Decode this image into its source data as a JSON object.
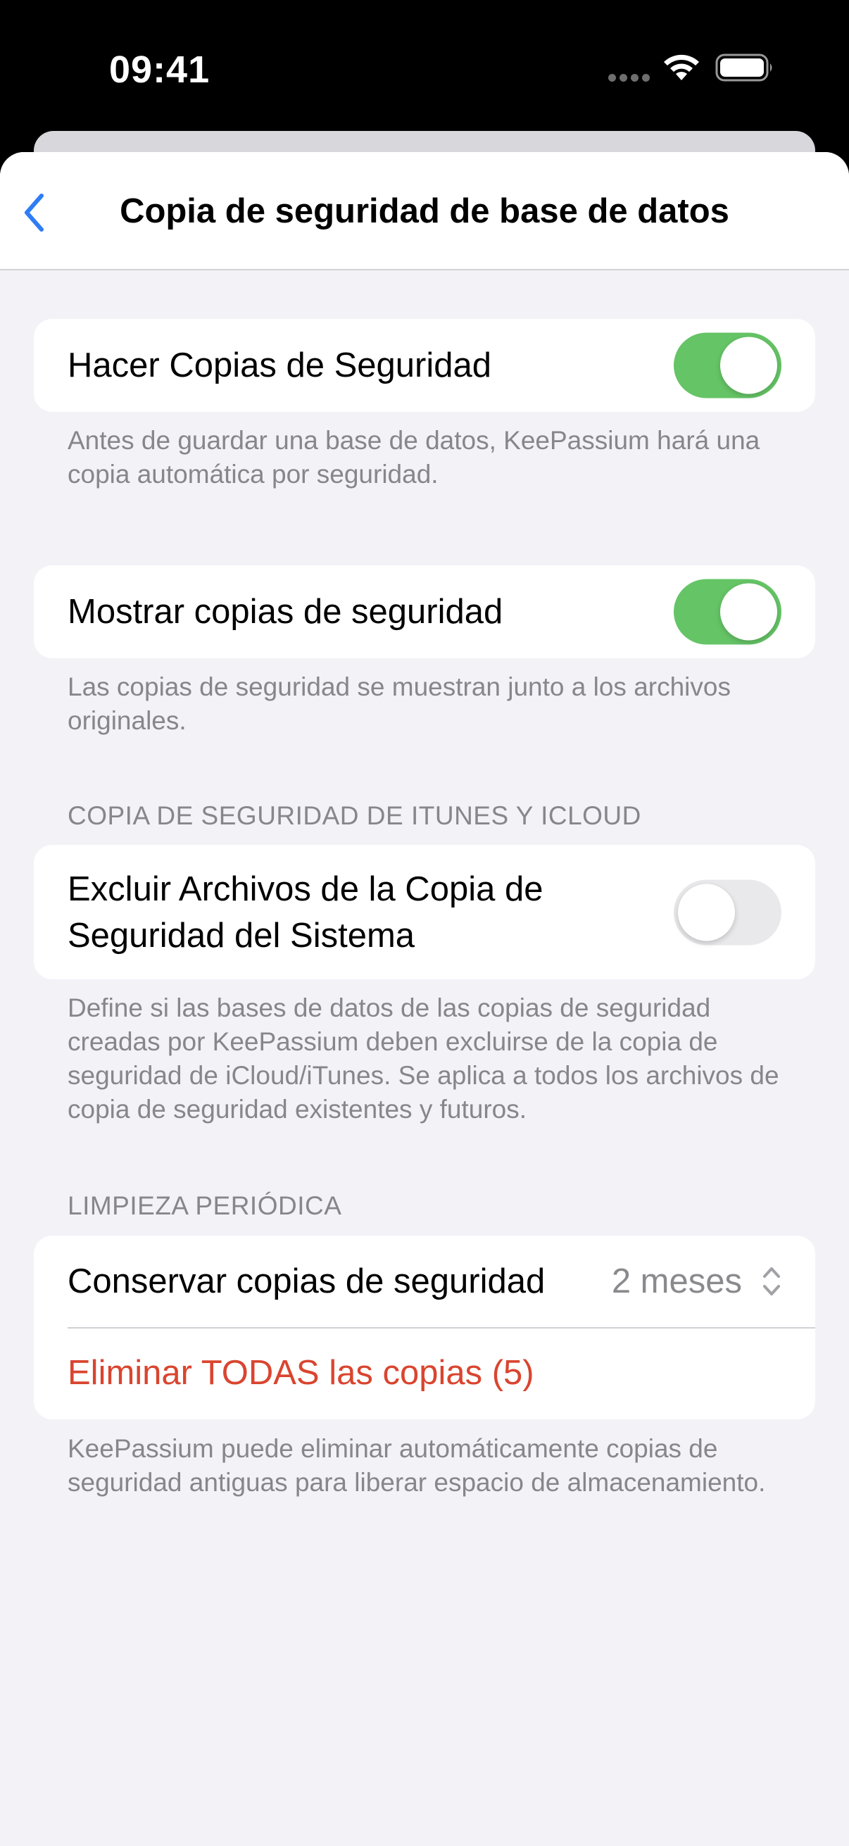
{
  "status_bar": {
    "time": "09:41",
    "icons": [
      "cellular-dots-icon",
      "wifi-icon",
      "battery-icon"
    ]
  },
  "nav": {
    "back_icon": "chevron-left-icon",
    "title": "Copia de seguridad de base de datos"
  },
  "sections": {
    "backup": {
      "label": "Hacer Copias de Seguridad",
      "enabled": true,
      "footer": "Antes de guardar una base de datos, KeePassium hará una copia automática por seguridad."
    },
    "show_backups": {
      "label": "Mostrar copias de seguridad",
      "enabled": true,
      "footer": "Las copias de seguridad se muestran junto a los archivos originales."
    },
    "itunes_icloud": {
      "header": "COPIA DE SEGURIDAD DE ITUNES Y ICLOUD",
      "label": "Excluir Archivos de la Copia de Seguridad del Sistema",
      "enabled": false,
      "footer": "Define si las bases de datos de las copias de seguridad creadas por KeePassium deben excluirse de la copia de seguridad de iCloud/iTunes. Se aplica a todos los archivos de copia de seguridad existentes y futuros."
    },
    "cleanup": {
      "header": "LIMPIEZA PERIÓDICA",
      "keep_label": "Conservar copias de seguridad",
      "keep_value": "2 meses",
      "delete_label": "Eliminar TODAS las copias (5)",
      "footer": "KeePassium puede eliminar automáticamente copias de seguridad antiguas para liberar espacio de almacenamiento."
    }
  },
  "colors": {
    "toggle_on": "#65c466",
    "toggle_off": "#e9e9eb",
    "accent": "#2f7df6",
    "destructive": "#d9452f",
    "secondary_text": "#86868b",
    "background": "#f2f2f7"
  }
}
